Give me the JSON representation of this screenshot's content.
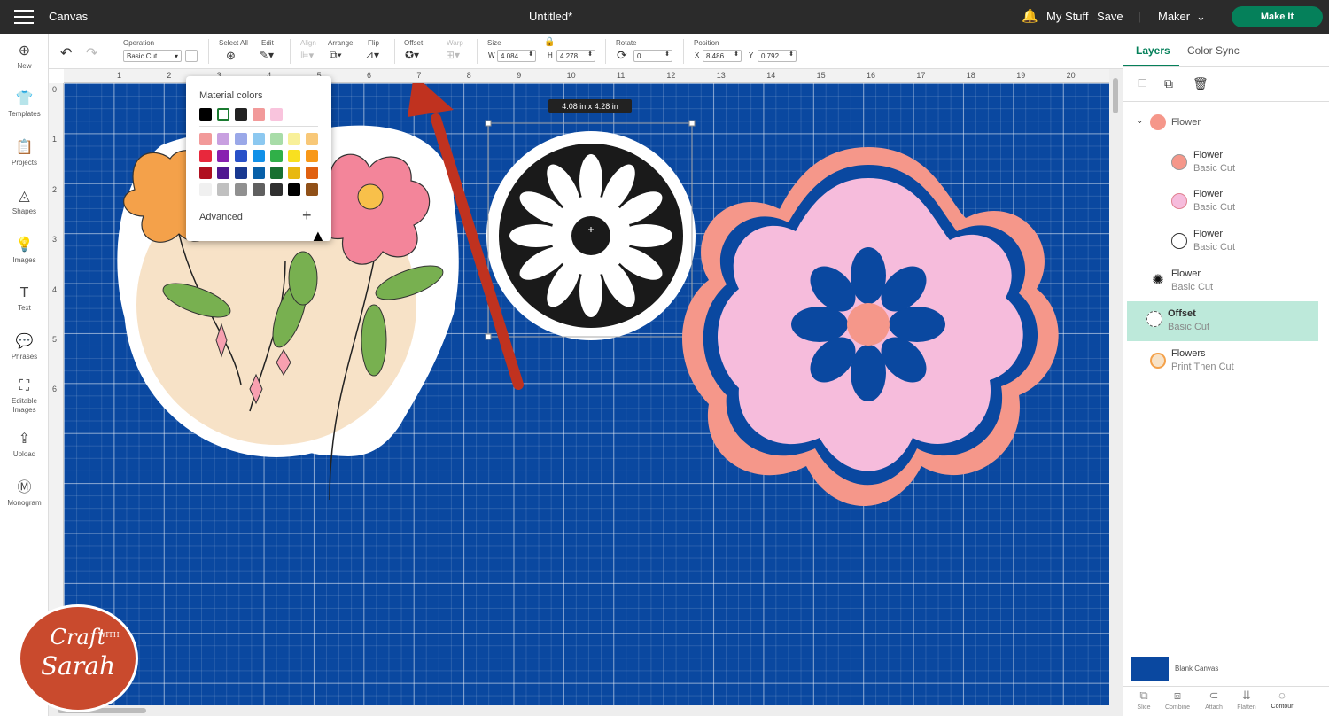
{
  "topbar": {
    "title": "Canvas",
    "doc_title": "Untitled*",
    "my_stuff": "My Stuff",
    "save": "Save",
    "machine": "Maker",
    "make_it": "Make It",
    "divider": "|"
  },
  "leftbar": {
    "items": [
      {
        "label": "New",
        "icon": "plus-circle-icon",
        "glyph": "⊕"
      },
      {
        "label": "Templates",
        "icon": "shirt-icon",
        "glyph": "👕"
      },
      {
        "label": "Projects",
        "icon": "clipboard-icon",
        "glyph": "📋"
      },
      {
        "label": "Shapes",
        "icon": "shapes-icon",
        "glyph": "◬"
      },
      {
        "label": "Images",
        "icon": "lightbulb-icon",
        "glyph": "💡"
      },
      {
        "label": "Text",
        "icon": "text-icon",
        "glyph": "T"
      },
      {
        "label": "Phrases",
        "icon": "speech-bubble-icon",
        "glyph": "💬"
      },
      {
        "label": "Editable Images",
        "icon": "editable-image-icon",
        "glyph": "⛶"
      },
      {
        "label": "Upload",
        "icon": "upload-icon",
        "glyph": "⇪"
      },
      {
        "label": "Monogram",
        "icon": "monogram-icon",
        "glyph": "Ⓜ"
      }
    ]
  },
  "toolbar": {
    "operation_label": "Operation",
    "operation_value": "Basic Cut",
    "select_all": "Select All",
    "edit": "Edit",
    "align": "Align",
    "arrange": "Arrange",
    "flip": "Flip",
    "offset": "Offset",
    "warp": "Warp",
    "size": "Size",
    "w_label": "W",
    "w_value": "4.084",
    "h_label": "H",
    "h_value": "4.278",
    "rotate": "Rotate",
    "rotate_value": "0",
    "position": "Position",
    "x_label": "X",
    "x_value": "8.486",
    "y_label": "Y",
    "y_value": "0.792"
  },
  "ruler": {
    "top": [
      "1",
      "2",
      "3",
      "4",
      "5",
      "6",
      "7",
      "8",
      "9",
      "10",
      "11",
      "12",
      "13",
      "14",
      "15",
      "16",
      "17",
      "18",
      "19",
      "20"
    ],
    "left": [
      "0",
      "1",
      "2",
      "3",
      "4",
      "5",
      "6"
    ]
  },
  "popup": {
    "title": "Material colors",
    "advanced": "Advanced",
    "add_glyph": "+",
    "row1": [
      "#000000",
      "#ffffff",
      "#222222",
      "#f29a9a",
      "#f9c4dd"
    ],
    "grid": [
      [
        "#f29a9a",
        "#c8a0e0",
        "#9aa8e8",
        "#8cc8f0",
        "#a8dca8",
        "#f8f09a",
        "#f8c878"
      ],
      [
        "#e8283c",
        "#8820b0",
        "#2850c8",
        "#1090e8",
        "#30b048",
        "#f8e020",
        "#f89818"
      ],
      [
        "#b01020",
        "#501890",
        "#183890",
        "#0860a8",
        "#187030",
        "#e8b810",
        "#e06010"
      ],
      [
        "#f0f0f0",
        "#c0c0c0",
        "#909090",
        "#606060",
        "#303030",
        "#000000",
        "#905018"
      ]
    ]
  },
  "canvas": {
    "size_badge": "4.08  in x 4.28  in",
    "zoom_partial": "%"
  },
  "layers": {
    "tab_layers": "Layers",
    "tab_color_sync": "Color Sync",
    "items": [
      {
        "name": "Flower",
        "sub": "",
        "thumb": "flower-group-thumb"
      },
      {
        "name": "Flower",
        "sub": "Basic Cut",
        "thumb": "salmon-circle-thumb"
      },
      {
        "name": "Flower",
        "sub": "Basic Cut",
        "thumb": "pink-flower-thumb"
      },
      {
        "name": "Flower",
        "sub": "Basic Cut",
        "thumb": "flower-outline-thumb"
      },
      {
        "name": "Flower",
        "sub": "Basic Cut",
        "thumb": "black-flower-thumb"
      },
      {
        "name": "Offset",
        "sub": "Basic Cut",
        "thumb": "offset-thumb"
      },
      {
        "name": "Flowers",
        "sub": "Print Then Cut",
        "thumb": "flowers-print-thumb"
      }
    ],
    "blank_canvas": "Blank Canvas",
    "bottom_tools": [
      "Slice",
      "Combine",
      "Attach",
      "Flatten",
      "Contour"
    ]
  },
  "logo": {
    "line1": "Craft",
    "line2": "WITH",
    "line3": "Sarah"
  },
  "colors": {
    "accent": "#05805a",
    "canvas_bg": "#0a48a0",
    "selected_layer": "#bde9da",
    "arrow": "#c0321f"
  }
}
